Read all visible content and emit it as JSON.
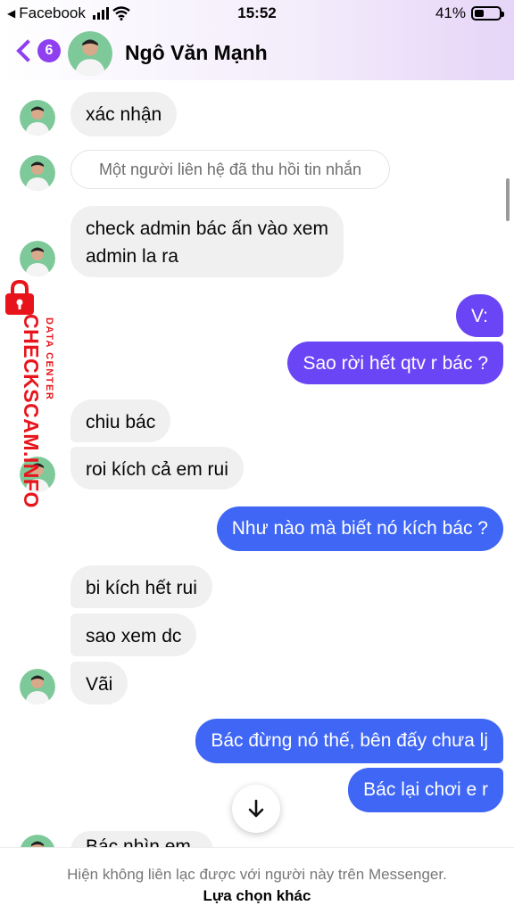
{
  "status_bar": {
    "back_app": "Facebook",
    "time": "15:52",
    "battery": "41%"
  },
  "header": {
    "back_count": "6",
    "contact_name": "Ngô Văn Mạnh"
  },
  "messages": [
    {
      "dir": "in",
      "text": "xác nhận"
    },
    {
      "dir": "system",
      "text": "Một người liên hệ đã thu hồi tin nhắn"
    },
    {
      "dir": "in",
      "line1": "check admin bác ấn vào xem",
      "line2": "admin la ra"
    },
    {
      "dir": "out",
      "text": "V:"
    },
    {
      "dir": "out",
      "text": "Sao rời hết qtv r bác ?"
    },
    {
      "dir": "in",
      "text": "chiu bác"
    },
    {
      "dir": "in",
      "text": "roi kích cả em rui"
    },
    {
      "dir": "out",
      "text": "Như nào mà biết nó kích bác ?"
    },
    {
      "dir": "in",
      "text": "bi kích hết rui"
    },
    {
      "dir": "in",
      "text": "sao xem dc"
    },
    {
      "dir": "in",
      "text": "Vãi"
    },
    {
      "dir": "out",
      "text": "Bác đừng nó thế, bên đấy chưa lj"
    },
    {
      "dir": "out",
      "text": "Bác lại chơi e r"
    },
    {
      "dir": "in",
      "text": "Bác nhìn em"
    }
  ],
  "watermark": {
    "brand": "CHECKSCAM.INFO",
    "tagline": "DATA CENTER"
  },
  "footer": {
    "note": "Hiện không liên lạc được với người này trên Messenger.",
    "link": "Lựa chọn khác"
  },
  "icons": {
    "back": "chevron-left-icon",
    "scroll": "arrow-down-icon",
    "lock": "lock-icon"
  },
  "colors": {
    "accent": "#8e3ff0",
    "outgoing_purple": "#6a45f5",
    "outgoing_blue": "#3f66f5",
    "incoming": "#f0f0f0",
    "watermark": "#e8141b"
  }
}
